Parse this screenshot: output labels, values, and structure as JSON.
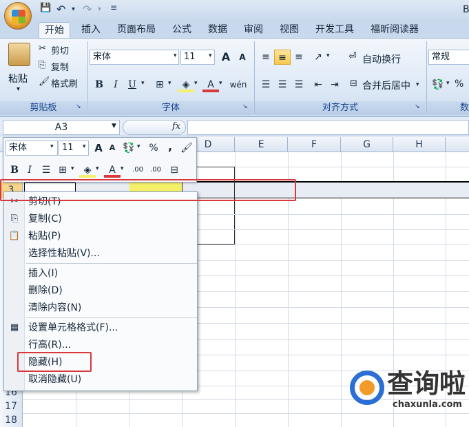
{
  "title_bar": {
    "window_title_partial": "B",
    "quick_access": {
      "save": "💾",
      "undo": "↶",
      "redo": "↷"
    }
  },
  "tabs": [
    "开始",
    "插入",
    "页面布局",
    "公式",
    "数据",
    "审阅",
    "视图",
    "开发工具",
    "福昕阅读器"
  ],
  "ribbon": {
    "clipboard": {
      "paste_label": "粘贴",
      "cut": "剪切",
      "copy": "复制",
      "format_painter": "格式刷",
      "group_label": "剪贴板"
    },
    "font": {
      "font_name": "宋体",
      "font_size": "11",
      "grow": "A",
      "shrink": "A",
      "bold": "B",
      "italic": "I",
      "underline": "U",
      "wen": "wén",
      "group_label": "字体"
    },
    "alignment": {
      "wrap_text": "自动换行",
      "merge_center": "合并后居中",
      "group_label": "对齐方式"
    },
    "number": {
      "format": "常规",
      "percent": "%",
      "group_label_partial": "数"
    }
  },
  "formula_bar": {
    "name_box": "A3",
    "fx": "fx",
    "content": ""
  },
  "columns": [
    "D",
    "E",
    "F",
    "G",
    "H"
  ],
  "rows": [
    "3",
    "16",
    "17",
    "18"
  ],
  "mini_toolbar": {
    "font_name": "宋体",
    "font_size": "11",
    "grow": "A",
    "shrink": "A",
    "percent": "%",
    "comma": ",",
    "bold": "B",
    "italic": "I",
    "inc_decimal": ".00",
    "dec_decimal": ".00"
  },
  "context_menu": {
    "items": [
      "剪切(T)",
      "复制(C)",
      "粘贴(P)",
      "选择性粘贴(V)...",
      "插入(I)",
      "删除(D)",
      "清除内容(N)",
      "设置单元格格式(F)...",
      "行高(R)...",
      "隐藏(H)",
      "取消隐藏(U)"
    ]
  },
  "watermark": {
    "brand": "查询啦",
    "url": "chaxunla.com"
  },
  "colors": {
    "accent": "#d9383a",
    "highlight_yellow": "#f5f06a",
    "ribbon_blue": "#15428b"
  }
}
